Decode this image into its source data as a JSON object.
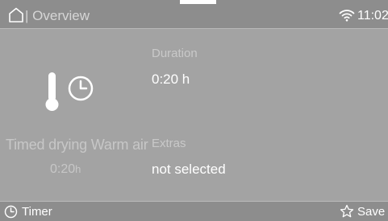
{
  "header": {
    "title": "| Overview",
    "time": "11:02",
    "home_icon": "home-icon",
    "wifi_icon": "wifi-icon"
  },
  "program": {
    "icon": "thermometer-clock-icon",
    "name": "Timed drying Warm air",
    "time": "0:20",
    "time_unit": "h"
  },
  "duration": {
    "label": "Duration",
    "value": "0:20 h"
  },
  "extras": {
    "label": "Extras",
    "value": "not selected"
  },
  "footer": {
    "timer_label": "Timer",
    "timer_icon": "clock-icon",
    "save_label": "Save",
    "save_icon": "star-icon"
  },
  "colors": {
    "background": "#a3a3a3",
    "bar": "#8d8d8d",
    "text": "#ffffff",
    "muted_text": "#c9c9c9"
  }
}
